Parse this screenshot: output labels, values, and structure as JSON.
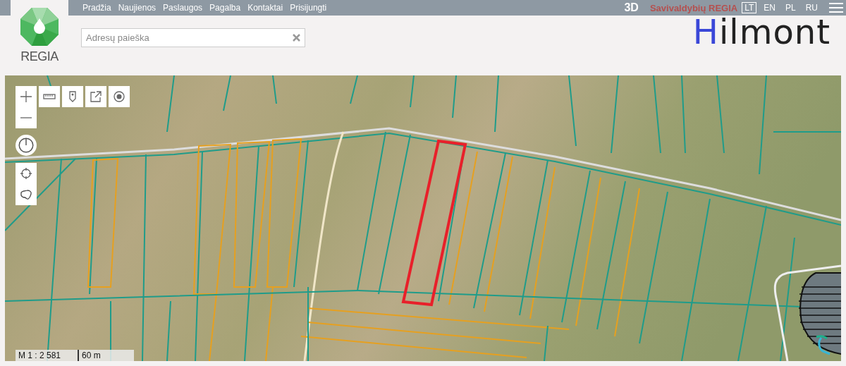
{
  "nav": {
    "links": [
      "Pradžia",
      "Naujienos",
      "Paslaugos",
      "Pagalba",
      "Kontaktai",
      "Prisijungti"
    ]
  },
  "logo": {
    "name": "REGIA"
  },
  "top_right": {
    "mode_3d": "3D",
    "portal": "Savivaldybių REGIA",
    "languages": [
      {
        "label": "LT",
        "selected": true
      },
      {
        "label": "EN",
        "selected": false
      },
      {
        "label": "PL",
        "selected": false
      },
      {
        "label": "RU",
        "selected": false
      }
    ]
  },
  "search": {
    "placeholder": "Adresų paieška"
  },
  "brand": {
    "text": "Hilmont"
  },
  "map": {
    "scale": "M 1 : 2 581",
    "scale_bar": "60 m"
  }
}
